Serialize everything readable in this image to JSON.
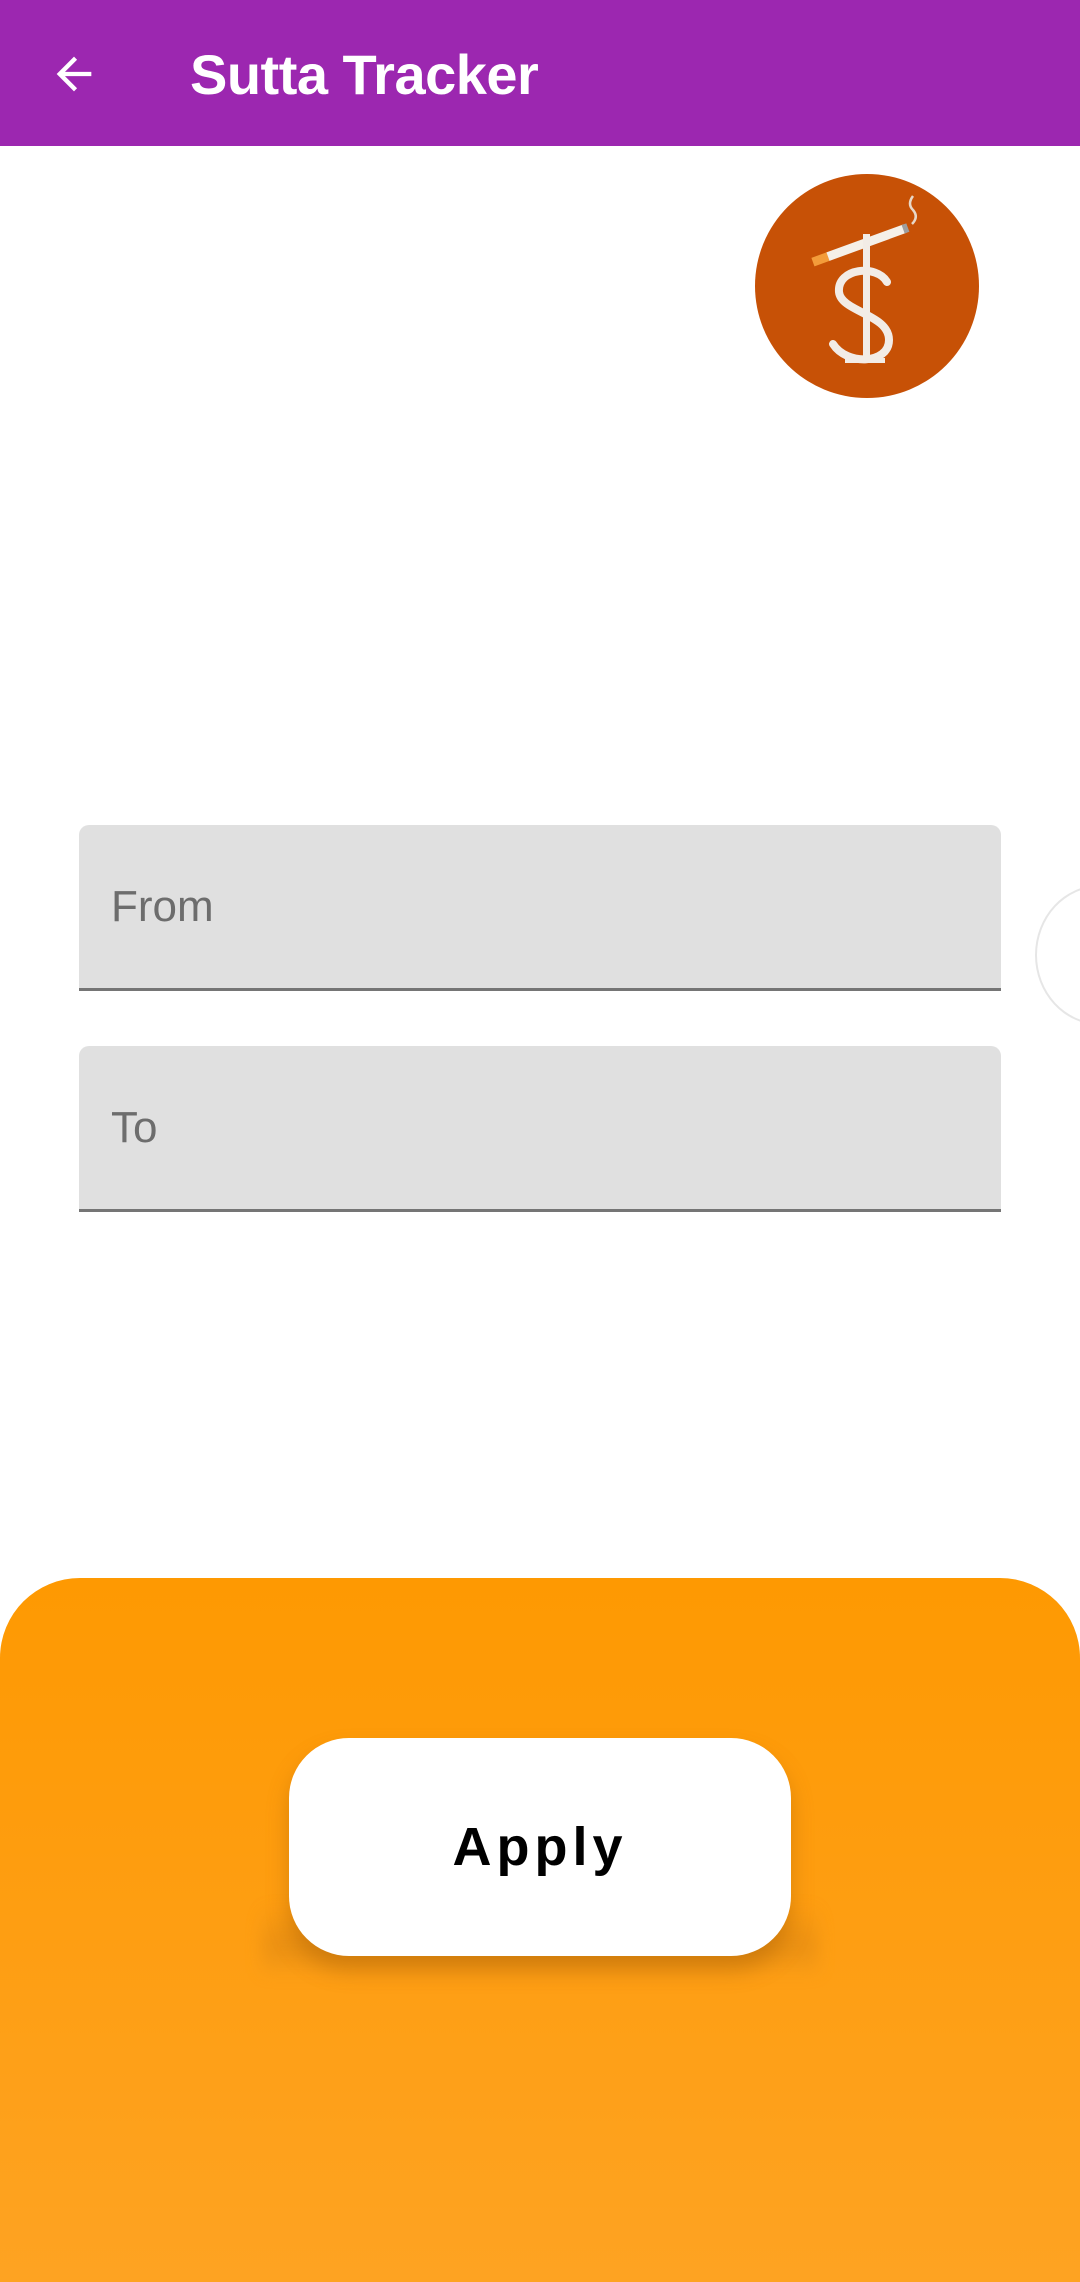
{
  "app_bar": {
    "title": "Sutta Tracker",
    "back_icon": "arrow-back-icon",
    "background": "#9c27b0"
  },
  "logo": {
    "icon": "sutta-tracker-logo-icon",
    "background": "#c75106"
  },
  "form": {
    "from_placeholder": "From",
    "from_value": "",
    "to_placeholder": "To",
    "to_value": ""
  },
  "bottom_panel": {
    "background": "#fe9902",
    "apply_label": "Apply"
  }
}
